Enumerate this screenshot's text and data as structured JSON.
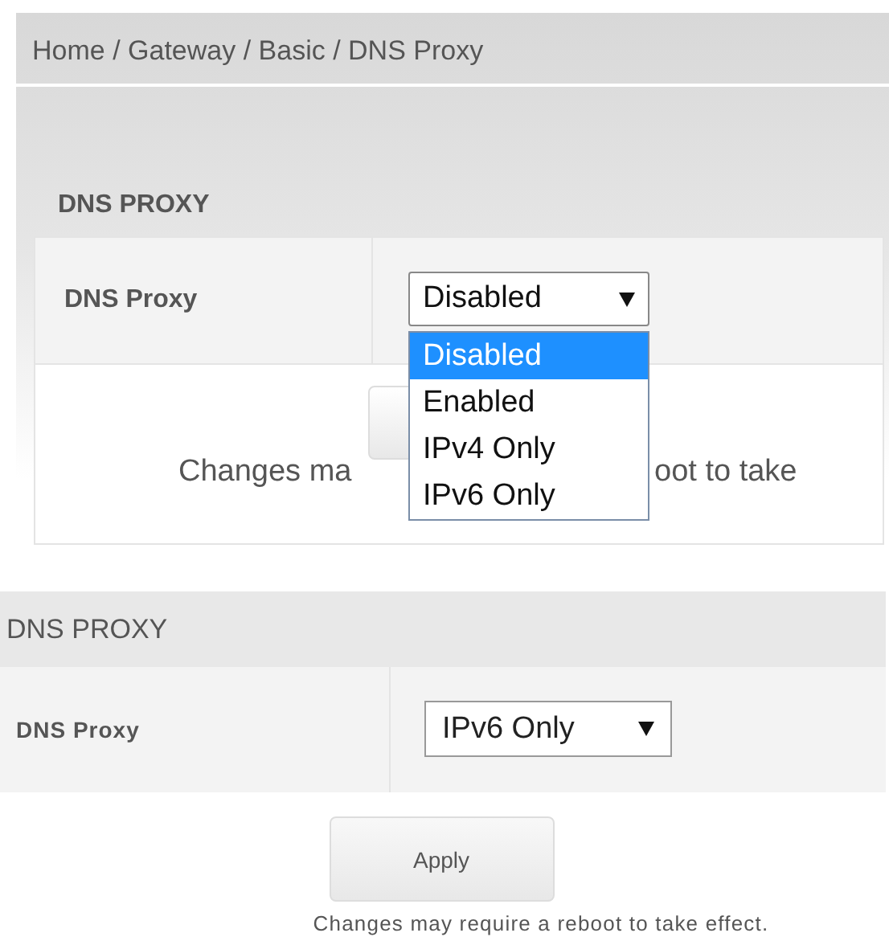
{
  "top_panel": {
    "breadcrumb": "Home / Gateway / Basic / DNS Proxy",
    "section_title": "DNS PROXY",
    "field": {
      "label": "DNS Proxy",
      "value": "Disabled",
      "options": [
        {
          "label": "Disabled",
          "selected": true
        },
        {
          "label": "Enabled",
          "selected": false
        },
        {
          "label": "IPv4 Only",
          "selected": false
        },
        {
          "label": "IPv6 Only",
          "selected": false
        }
      ]
    },
    "note_parts": [
      "Changes ma",
      "oot to take"
    ]
  },
  "bottom_panel": {
    "section_title": "DNS PROXY",
    "field": {
      "label": "DNS Proxy",
      "value": "IPv6 Only"
    },
    "apply_button": "Apply",
    "note": "Changes may require a reboot to take effect."
  }
}
